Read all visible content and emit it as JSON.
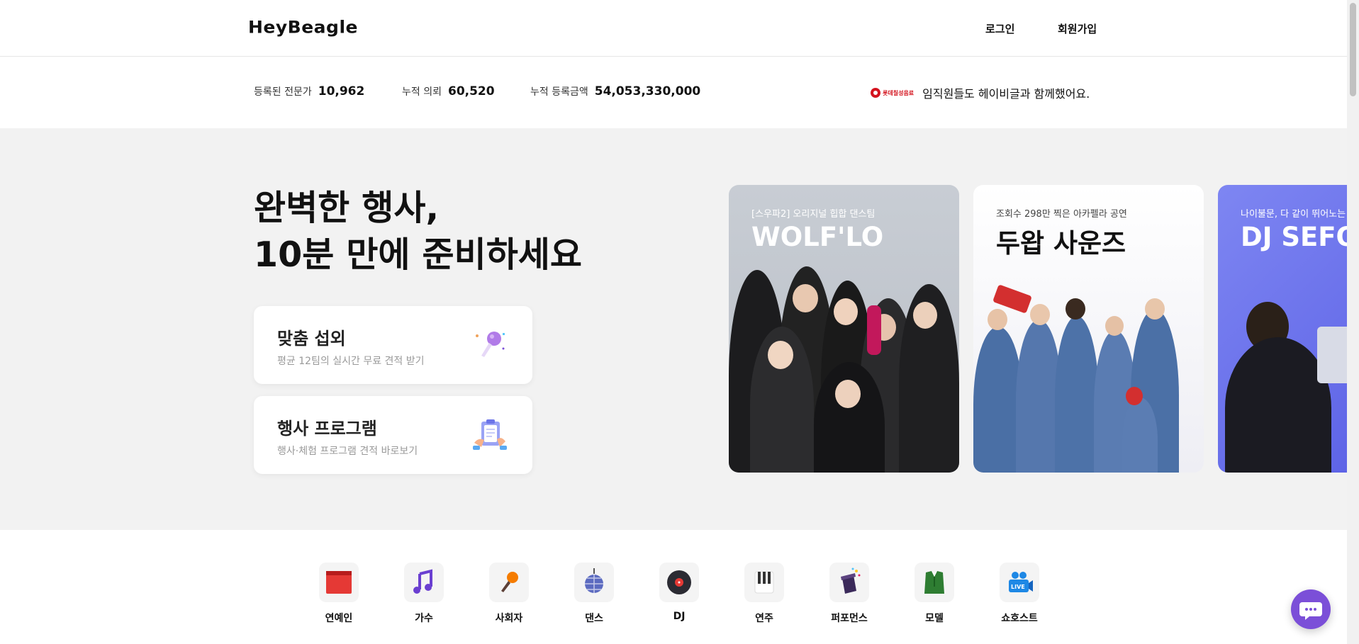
{
  "header": {
    "logo": "HeyBeagle",
    "login": "로그인",
    "signup": "회원가입"
  },
  "stats": {
    "experts_label": "등록된 전문가",
    "experts_value": "10,962",
    "requests_label": "누적 의뢰",
    "requests_value": "60,520",
    "amount_label": "누적 등록금액",
    "amount_value": "54,053,330,000",
    "partner_logo": "롯데칠성음료",
    "partner_text": "임직원들도 헤이비글과 함께했어요."
  },
  "hero": {
    "title_line1": "완벽한 행사,",
    "title_line2": "10분 만에 준비하세요",
    "cards": [
      {
        "title": "맞춤 섭외",
        "subtitle": "평균 12팀의 실시간 무료 견적 받기",
        "icon": "microphone-icon"
      },
      {
        "title": "행사 프로그램",
        "subtitle": "행사·체험 프로그램 견적 바로보기",
        "icon": "clipboard-icon"
      }
    ],
    "showcase": [
      {
        "subtitle": "[스우파2] 오리지널 힙합 댄스팀",
        "title": "WOLF'LO"
      },
      {
        "subtitle": "조회수 298만 찍은 아카펠라 공연",
        "title": "두왑 사운즈"
      },
      {
        "subtitle": "나이불문, 다 같이 뛰어노는",
        "title": "DJ SEFO"
      }
    ]
  },
  "categories": [
    {
      "label": "연예인",
      "icon": "curtain-icon"
    },
    {
      "label": "가수",
      "icon": "music-note-icon"
    },
    {
      "label": "사회자",
      "icon": "microphone-icon"
    },
    {
      "label": "댄스",
      "icon": "disco-ball-icon"
    },
    {
      "label": "DJ",
      "icon": "vinyl-record-icon"
    },
    {
      "label": "연주",
      "icon": "piano-keys-icon"
    },
    {
      "label": "퍼포먼스",
      "icon": "magic-hat-icon"
    },
    {
      "label": "모델",
      "icon": "suit-icon"
    },
    {
      "label": "쇼호스트",
      "icon": "live-camera-icon"
    }
  ],
  "colors": {
    "hero_bg": "#f2f2f2",
    "chat_button": "#7b4fd8",
    "partner_red": "#d4141f"
  }
}
